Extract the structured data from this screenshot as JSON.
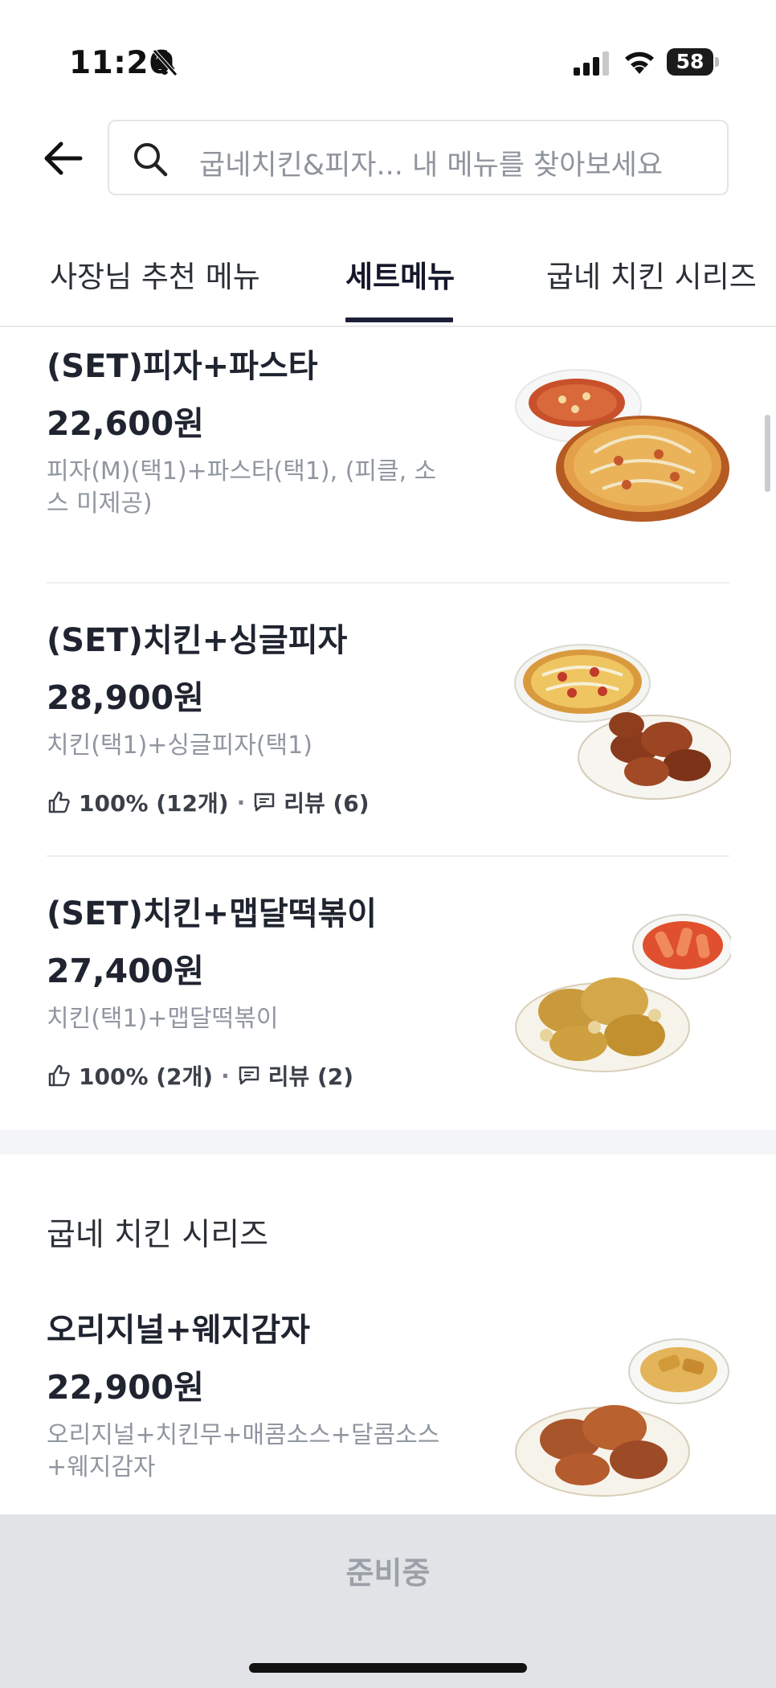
{
  "status_bar": {
    "time": "11:26",
    "battery": "58"
  },
  "search": {
    "placeholder": "굽네치킨&피자...  내 메뉴를 찾아보세요"
  },
  "tabs": [
    {
      "label": "사장님 추천 메뉴"
    },
    {
      "label": "세트메뉴"
    },
    {
      "label": "굽네 치킨 시리즈"
    }
  ],
  "items": [
    {
      "name": "(SET)피자+파스타",
      "price": "22,600원",
      "desc": "피자(M)(택1)+파스타(택1), (피클, 소스 미제공)"
    },
    {
      "name": "(SET)치킨+싱글피자",
      "price": "28,900원",
      "desc": "치킨(택1)+싱글피자(택1)",
      "like": "100% (12개)",
      "review": "리뷰 (6)"
    },
    {
      "name": "(SET)치킨+맵달떡볶이",
      "price": "27,400원",
      "desc": "치킨(택1)+맵달떡볶이",
      "like": "100% (2개)",
      "review": "리뷰 (2)"
    }
  ],
  "section": {
    "title": "굽네 치킨 시리즈"
  },
  "section_items": [
    {
      "name": "오리지널+웨지감자",
      "price": "22,900원",
      "desc": "오리지널+치킨무+매콤소스+달콤소스+웨지감자"
    }
  ],
  "bottom": {
    "button_label": "준비중"
  },
  "icons": [
    "bell-slash-icon",
    "signal-icon",
    "wifi-icon",
    "battery-icon",
    "back-arrow-icon",
    "search-icon",
    "thumbs-up-icon",
    "review-bubble-icon"
  ],
  "colors": {
    "tab_indicator": "#1c1f3a",
    "bottom_bar": "#e1e3e7",
    "muted_text": "#9096a0"
  }
}
